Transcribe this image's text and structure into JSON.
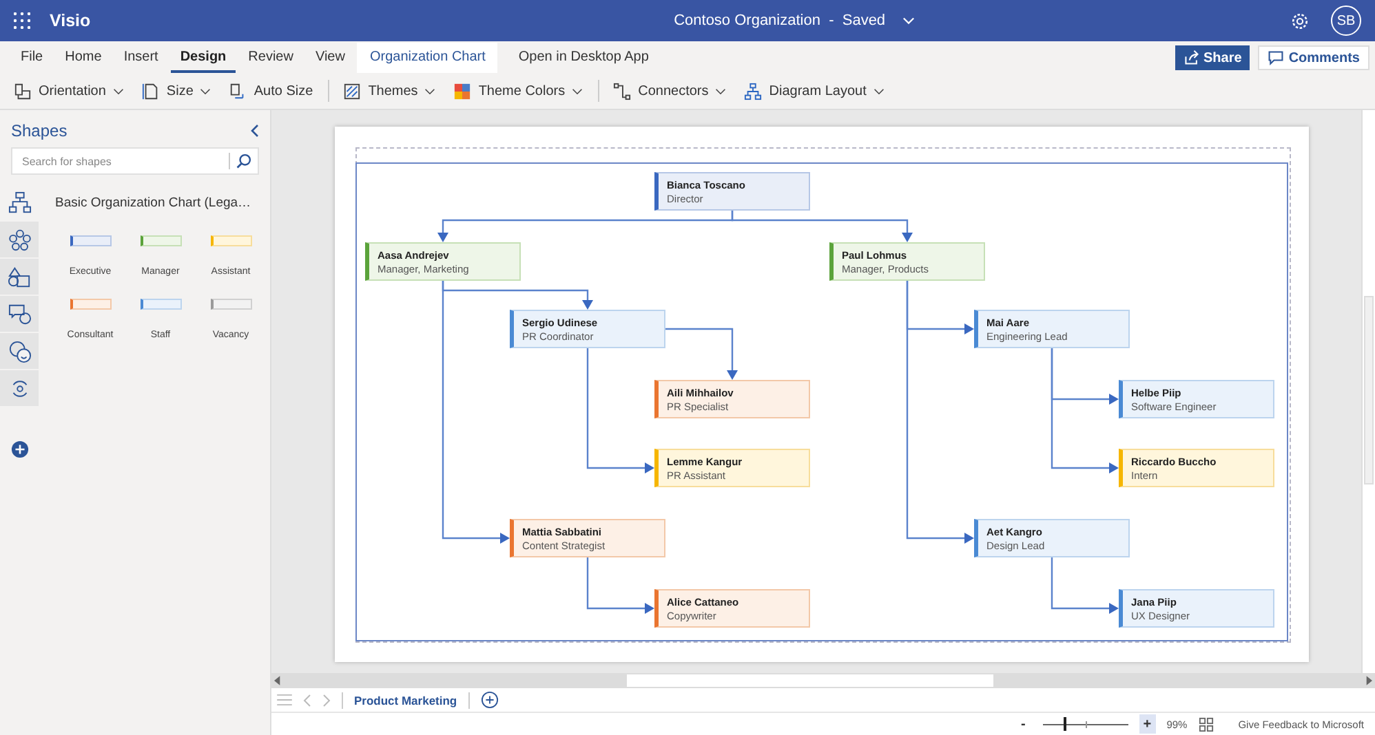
{
  "title_bar": {
    "app_name": "Visio",
    "document_title": "Contoso Organization  -  Saved",
    "avatar_initials": "SB"
  },
  "ribbon_tabs": [
    {
      "label": "File",
      "selected": false,
      "kind": "standard"
    },
    {
      "label": "Home",
      "selected": false,
      "kind": "standard"
    },
    {
      "label": "Insert",
      "selected": false,
      "kind": "standard"
    },
    {
      "label": "Design",
      "selected": true,
      "kind": "standard"
    },
    {
      "label": "Review",
      "selected": false,
      "kind": "standard"
    },
    {
      "label": "View",
      "selected": false,
      "kind": "standard"
    },
    {
      "label": "Organization Chart",
      "selected": false,
      "kind": "contextual"
    },
    {
      "label": "Open in Desktop App",
      "selected": false,
      "kind": "command"
    }
  ],
  "share_button": "Share",
  "comments_button": "Comments",
  "toolbar_groups": [
    [
      {
        "label": "Orientation",
        "dropdown": true
      },
      {
        "label": "Size",
        "dropdown": true
      },
      {
        "label": "Auto Size",
        "dropdown": false
      }
    ],
    [
      {
        "label": "Themes",
        "dropdown": true
      },
      {
        "label": "Theme Colors",
        "dropdown": true
      }
    ],
    [
      {
        "label": "Connectors",
        "dropdown": true
      },
      {
        "label": "Diagram Layout",
        "dropdown": true
      }
    ]
  ],
  "shapes_pane": {
    "title": "Shapes",
    "search": {
      "placeholder": "Search for shapes"
    },
    "categories": [
      {
        "selected": true
      },
      {
        "selected": false
      },
      {
        "selected": false
      },
      {
        "selected": false
      },
      {
        "selected": false
      },
      {
        "selected": false
      }
    ],
    "stencil_title": "Basic Organization Chart (Lega…",
    "stencil_shapes": [
      {
        "label": "Executive",
        "kind": "executive"
      },
      {
        "label": "Manager",
        "kind": "manager"
      },
      {
        "label": "Assistant",
        "kind": "assistant"
      },
      {
        "label": "Consultant",
        "kind": "consultant"
      },
      {
        "label": "Staff",
        "kind": "staff"
      },
      {
        "label": "Vacancy",
        "kind": "vacancy"
      }
    ]
  },
  "org_chart": {
    "name": "Bianca Toscano",
    "title": "Director",
    "kind": "executive",
    "children": [
      {
        "name": "Aasa Andrejev",
        "title": "Manager, Marketing",
        "kind": "manager",
        "children": [
          {
            "name": "Sergio Udinese",
            "title": "PR Coordinator",
            "kind": "staff",
            "children": [
              {
                "name": "Aili Mihhailov",
                "title": "PR Specialist",
                "kind": "consultant"
              },
              {
                "name": "Lemme Kangur",
                "title": "PR Assistant",
                "kind": "assistant"
              }
            ]
          },
          {
            "name": "Mattia Sabbatini",
            "title": "Content Strategist",
            "kind": "consultant",
            "children": [
              {
                "name": "Alice Cattaneo",
                "title": "Copywriter",
                "kind": "consultant"
              }
            ]
          }
        ]
      },
      {
        "name": "Paul Lohmus",
        "title": "Manager, Products",
        "kind": "manager",
        "children": [
          {
            "name": "Mai Aare",
            "title": "Engineering Lead",
            "kind": "staff",
            "children": [
              {
                "name": "Helbe Piip",
                "title": "Software Engineer",
                "kind": "staff"
              },
              {
                "name": "Riccardo Buccho",
                "title": "Intern",
                "kind": "assistant"
              }
            ]
          },
          {
            "name": "Aet Kangro",
            "title": "Design Lead",
            "kind": "staff",
            "children": [
              {
                "name": "Jana Piip",
                "title": "UX Designer",
                "kind": "staff"
              }
            ]
          }
        ]
      }
    ]
  },
  "sheet_tabs": [
    {
      "label": "Product Marketing",
      "selected": true
    }
  ],
  "status_bar": {
    "zoom_out": "-",
    "zoom": {
      "level": 0.25,
      "reading": "99%"
    },
    "zoom_in": "+",
    "feedback": "Give Feedback to Microsoft"
  }
}
